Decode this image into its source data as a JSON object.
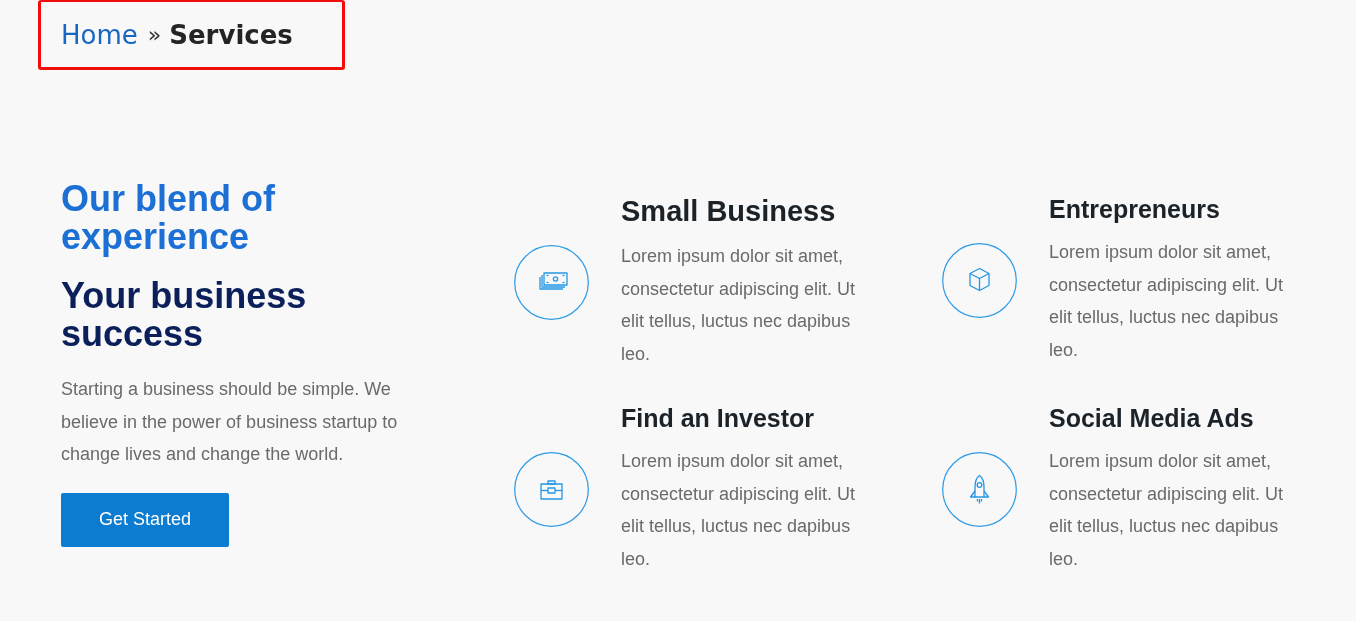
{
  "breadcrumb": {
    "highlighted": true,
    "separator": "»",
    "items": [
      {
        "label": "Home",
        "current": false
      },
      {
        "label": "Services",
        "current": true
      }
    ]
  },
  "hero": {
    "eyebrow": "Our blend of experience",
    "title": "Your business success",
    "text": "Starting a business should be simple. We believe in the power of business startup to change lives and change the world.",
    "button": "Get Started"
  },
  "services": [
    {
      "kind": "cash",
      "title": "Small Business",
      "text": "Lorem ipsum dolor sit amet, consectetur adipiscing elit. Ut elit tellus, luctus nec dapibus leo."
    },
    {
      "kind": "cube",
      "title": "Entrepreneurs",
      "text": "Lorem ipsum dolor sit amet, consectetur adipiscing elit. Ut elit tellus, luctus nec dapibus leo."
    },
    {
      "kind": "briefcase",
      "title": "Find an Investor",
      "text": "Lorem ipsum dolor sit amet, consectetur adipiscing elit. Ut elit tellus, luctus nec dapibus leo."
    },
    {
      "kind": "rocket",
      "title": "Social Media Ads",
      "text": "Lorem ipsum dolor sit amet, consectetur adipiscing elit. Ut elit tellus, luctus nec dapibus leo."
    }
  ]
}
